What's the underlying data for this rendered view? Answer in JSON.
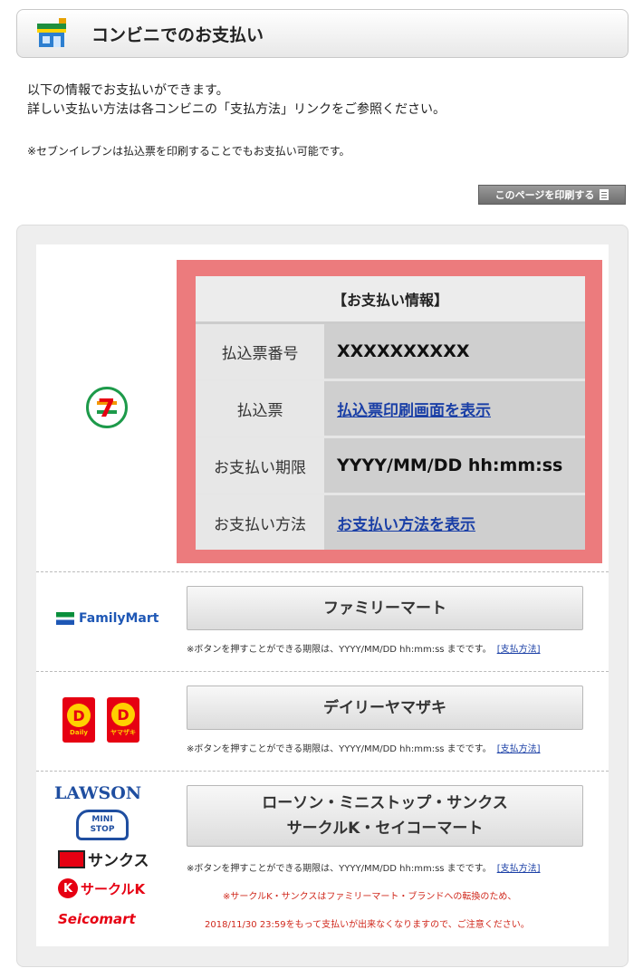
{
  "header": {
    "title": "コンビニでのお支払い"
  },
  "intro": {
    "line1": "以下の情報でお支払いができます。",
    "line2": "詳しい支払い方法は各コンビニの「支払方法」リンクをご参照ください。",
    "note": "※セブンイレブンは払込票を印刷することでもお支払い可能です。"
  },
  "print_button": {
    "label": "このページを印刷する"
  },
  "seven_eleven": {
    "logo_text": "7",
    "info_title": "【お支払い情報】",
    "rows": [
      {
        "label": "払込票番号",
        "value": "XXXXXXXXXX"
      },
      {
        "label": "払込票",
        "link": "払込票印刷画面を表示"
      },
      {
        "label": "お支払い期限",
        "value": "YYYY/MM/DD hh:mm:ss"
      },
      {
        "label": "お支払い方法",
        "link": "お支払い方法を表示"
      }
    ]
  },
  "familymart": {
    "logo_text": "FamilyMart",
    "button": "ファミリーマート",
    "deadline": "※ボタンを押すことができる期限は、YYYY/MM/DD hh:mm:ss までです。",
    "method_link": "[支払方法]"
  },
  "daily": {
    "logo1_text": "Daily",
    "logo2_text": "ヤマザキ",
    "logo_mark": "D",
    "button": "デイリーヤマザキ",
    "deadline": "※ボタンを押すことができる期限は、YYYY/MM/DD hh:mm:ss までです。",
    "method_link": "[支払方法]"
  },
  "lawson_group": {
    "logos": {
      "lawson": "LAWSON",
      "ministop_line1": "MINI",
      "ministop_line2": "STOP",
      "sunkus": "サンクス",
      "circlek_mark": "K",
      "circlek": "サークルK",
      "seicomart": "Seicomart"
    },
    "button_line1": "ローソン・ミニストップ・サンクス",
    "button_line2": "サークルK・セイコーマート",
    "deadline": "※ボタンを押すことができる期限は、YYYY/MM/DD hh:mm:ss までです。",
    "method_link": "[支払方法]",
    "warning_line1": "※サークルK・サンクスはファミリーマート・ブランドへの転換のため、",
    "warning_line2": "2018/11/30 23:59をもって支払いが出来なくなりますので、ご注意ください。"
  },
  "colors": {
    "info_box_border": "#ec7b7d",
    "link": "#1a3fa6",
    "warning": "#d0281c"
  }
}
